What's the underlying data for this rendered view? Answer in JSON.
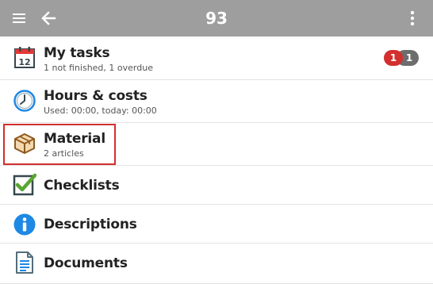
{
  "appbar": {
    "title": "93",
    "menu_icon": "hamburger-menu-icon",
    "back_icon": "arrow-back-icon",
    "more_icon": "more-vert-icon"
  },
  "items": [
    {
      "label": "My tasks",
      "sub": "1 not finished, 1 overdue",
      "icon": "calendar-icon",
      "badges": [
        "1",
        "1"
      ]
    },
    {
      "label": "Hours & costs",
      "sub": "Used: 00:00, today: 00:00",
      "icon": "clock-icon"
    },
    {
      "label": "Material",
      "sub": "2 articles",
      "icon": "box-icon"
    },
    {
      "label": "Checklists",
      "icon": "checkbox-icon"
    },
    {
      "label": "Descriptions",
      "icon": "info-icon"
    },
    {
      "label": "Documents",
      "icon": "document-icon"
    }
  ],
  "colors": {
    "appbar": "#9e9e9e",
    "badge_red": "#d32f2f",
    "badge_grey": "#6d6d6d",
    "highlight": "#d32f2f",
    "accent_blue": "#1e88e5",
    "check_green": "#5aa532"
  }
}
